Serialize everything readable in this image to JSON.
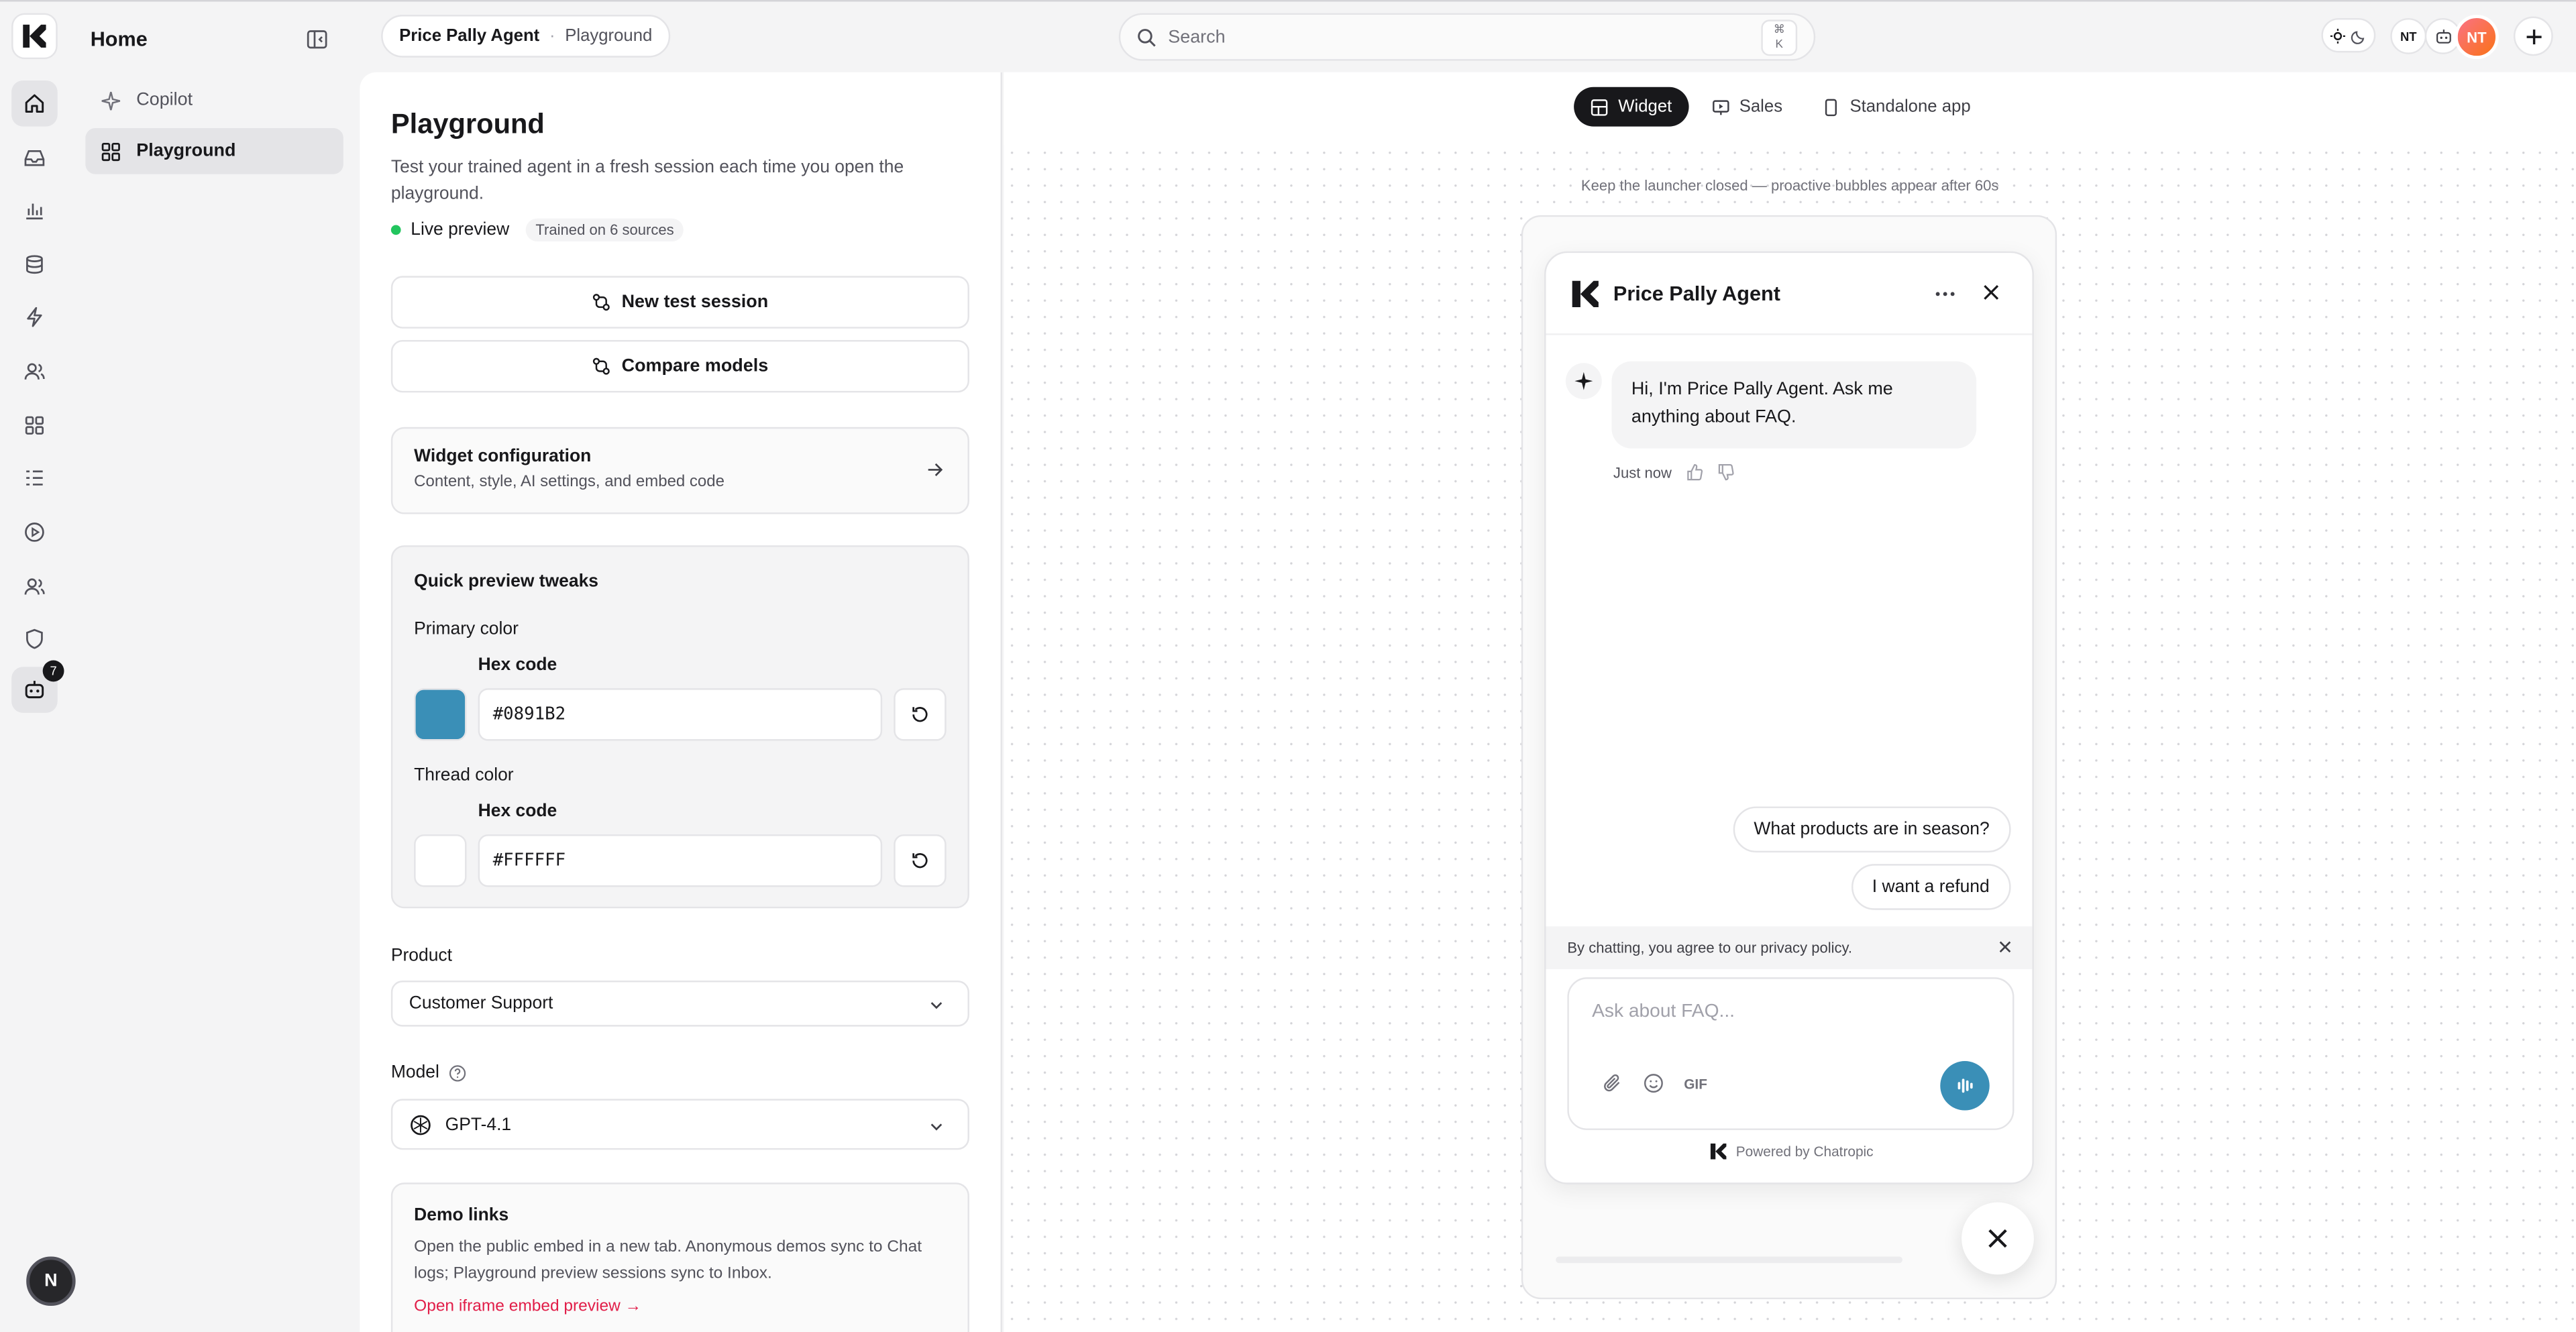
{
  "header": {
    "home_title": "Home",
    "breadcrumb": {
      "agent": "Price Pally Agent",
      "page": "Playground"
    },
    "search": {
      "placeholder": "Search",
      "kbd_top": "⌘",
      "kbd_bottom": "K"
    },
    "user_initials": "NT",
    "rail_badge": "7",
    "rail_user": "N"
  },
  "subnav": {
    "items": [
      {
        "label": "Copilot",
        "icon": "sparkle-icon"
      },
      {
        "label": "Playground",
        "icon": "grid-icon"
      }
    ]
  },
  "playground": {
    "title": "Playground",
    "subtitle": "Test your trained agent in a fresh session each time you open the playground.",
    "live_label": "Live preview",
    "trained_badge": "Trained on 6 sources",
    "new_session": "New test session",
    "compare_models": "Compare models",
    "widget_config": {
      "title": "Widget configuration",
      "subtitle": "Content, style, AI settings, and embed code"
    },
    "tweaks": {
      "title": "Quick preview tweaks",
      "primary_label": "Primary color",
      "primary_hex_label": "Hex code",
      "primary_value": "#0891B2",
      "primary_swatch": "#3a8fb7",
      "thread_label": "Thread color",
      "thread_hex_label": "Hex code",
      "thread_value": "#FFFFFF",
      "thread_swatch": "#ffffff"
    },
    "product": {
      "label": "Product",
      "value": "Customer Support"
    },
    "model": {
      "label": "Model",
      "value": "GPT-4.1"
    },
    "demo": {
      "title": "Demo links",
      "text": "Open the public embed in a new tab. Anonymous demos sync to Chat logs; Playground preview sessions sync to Inbox.",
      "link": "Open iframe embed preview →"
    }
  },
  "preview": {
    "tabs": [
      {
        "label": "Widget",
        "icon": "layout-icon",
        "active": true
      },
      {
        "label": "Sales",
        "icon": "presentation-icon",
        "active": false
      },
      {
        "label": "Standalone app",
        "icon": "phone-icon",
        "active": false
      }
    ],
    "hint": "Keep the launcher closed — proactive bubbles appear after 60s",
    "chat": {
      "name": "Price Pally Agent",
      "greeting": "Hi, I'm Price Pally Agent. Ask me anything about FAQ.",
      "timestamp": "Just now",
      "suggestions": [
        "What products are in season?",
        "I want a refund"
      ],
      "consent": "By chatting, you agree to our privacy policy.",
      "input_placeholder": "Ask about FAQ...",
      "gif_label": "GIF",
      "powered_by": "Powered by Chatropic"
    }
  }
}
